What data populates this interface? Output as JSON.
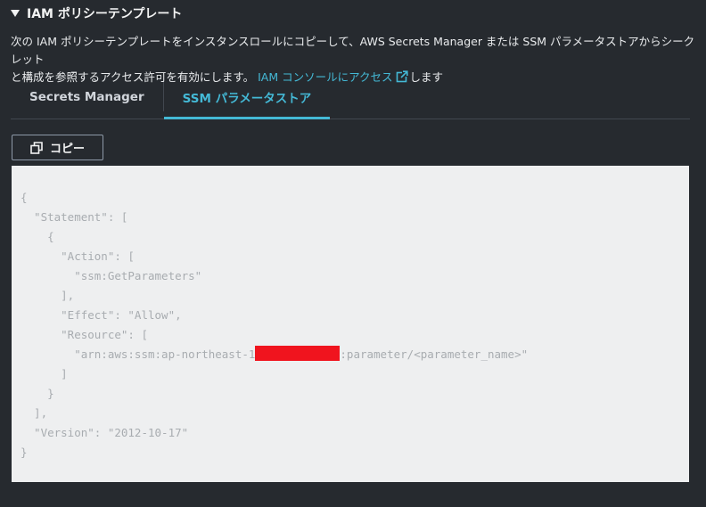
{
  "section": {
    "title": "IAM ポリシーテンプレート",
    "description_line1": "次の IAM ポリシーテンプレートをインスタンスロールにコピーして、AWS Secrets Manager または SSM パラメータストアからシークレット",
    "description_line2_prefix": "と構成を参照するアクセス許可を有効にします。",
    "description_link": "IAM コンソールにアクセス",
    "description_line2_suffix": "します"
  },
  "tabs": [
    {
      "label": "Secrets Manager",
      "active": false
    },
    {
      "label": "SSM パラメータストア",
      "active": true
    }
  ],
  "copy_button": {
    "label": "コピー"
  },
  "code": {
    "line1": "{",
    "line2": "  \"Statement\": [",
    "line3": "    {",
    "line4": "      \"Action\": [",
    "line5": "        \"ssm:GetParameters\"",
    "line6": "      ],",
    "line7": "      \"Effect\": \"Allow\",",
    "line8": "      \"Resource\": [",
    "line9_prefix": "        \"arn:aws:ssm:ap-northeast-1",
    "line9_suffix": ":parameter/<parameter_name>\"",
    "line10": "      ]",
    "line11": "    }",
    "line12": "  ],",
    "line13": "  \"Version\": \"2012-10-17\"",
    "line14": "}"
  },
  "colors": {
    "background": "#262a2f",
    "accent": "#44b9d6",
    "code_background": "#eeeff0",
    "redaction": "#f0141e"
  },
  "icons": {
    "caret": "caret-down-icon",
    "external_link": "external-link-icon",
    "copy": "copy-icon"
  }
}
